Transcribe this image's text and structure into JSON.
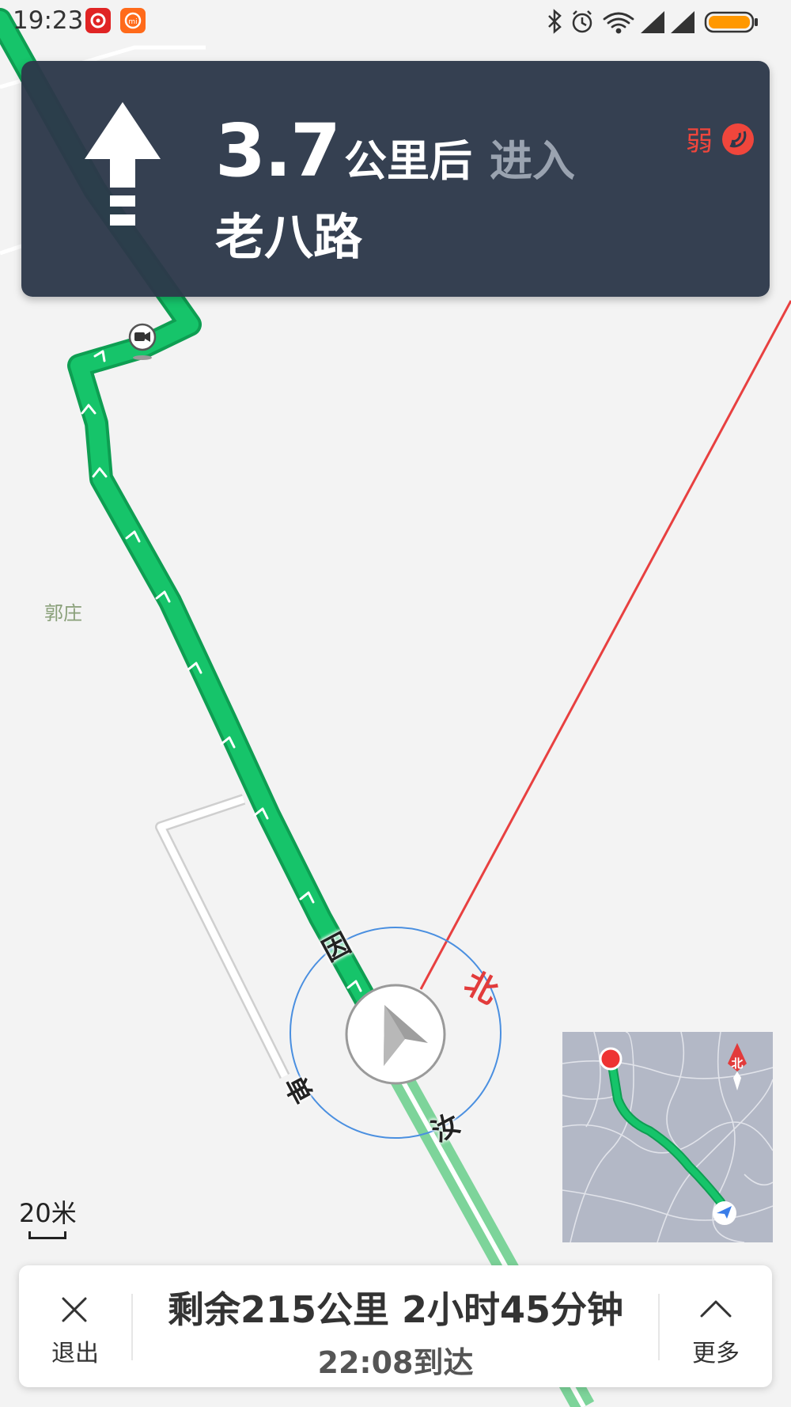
{
  "status_bar": {
    "time": "19:23",
    "icons": [
      "netease-music-icon",
      "mi-app-icon",
      "bluetooth-icon",
      "alarm-icon",
      "wifi-icon",
      "signal-icon",
      "signal-icon",
      "battery-icon"
    ],
    "battery_color": "#ff9800"
  },
  "navigation": {
    "maneuver_icon": "straight-arrow-icon",
    "distance": "3.7",
    "distance_unit": "公里后",
    "action": "进入",
    "road_name": "老八路",
    "gps_status": "弱",
    "gps_color": "#f0463c"
  },
  "map": {
    "place_label": "郭庄",
    "road_chars": [
      "因",
      "单",
      "汝"
    ],
    "compass_north": "北",
    "scale_label": "20米",
    "route_color": "#16c46a",
    "heading_line_color": "#e84040",
    "compass_ring_color": "#4a8fe0"
  },
  "minimap": {
    "north_label": "北"
  },
  "trip": {
    "remaining": "剩余215公里 2小时45分钟",
    "arrival": "22:08到达",
    "exit_label": "退出",
    "more_label": "更多"
  }
}
